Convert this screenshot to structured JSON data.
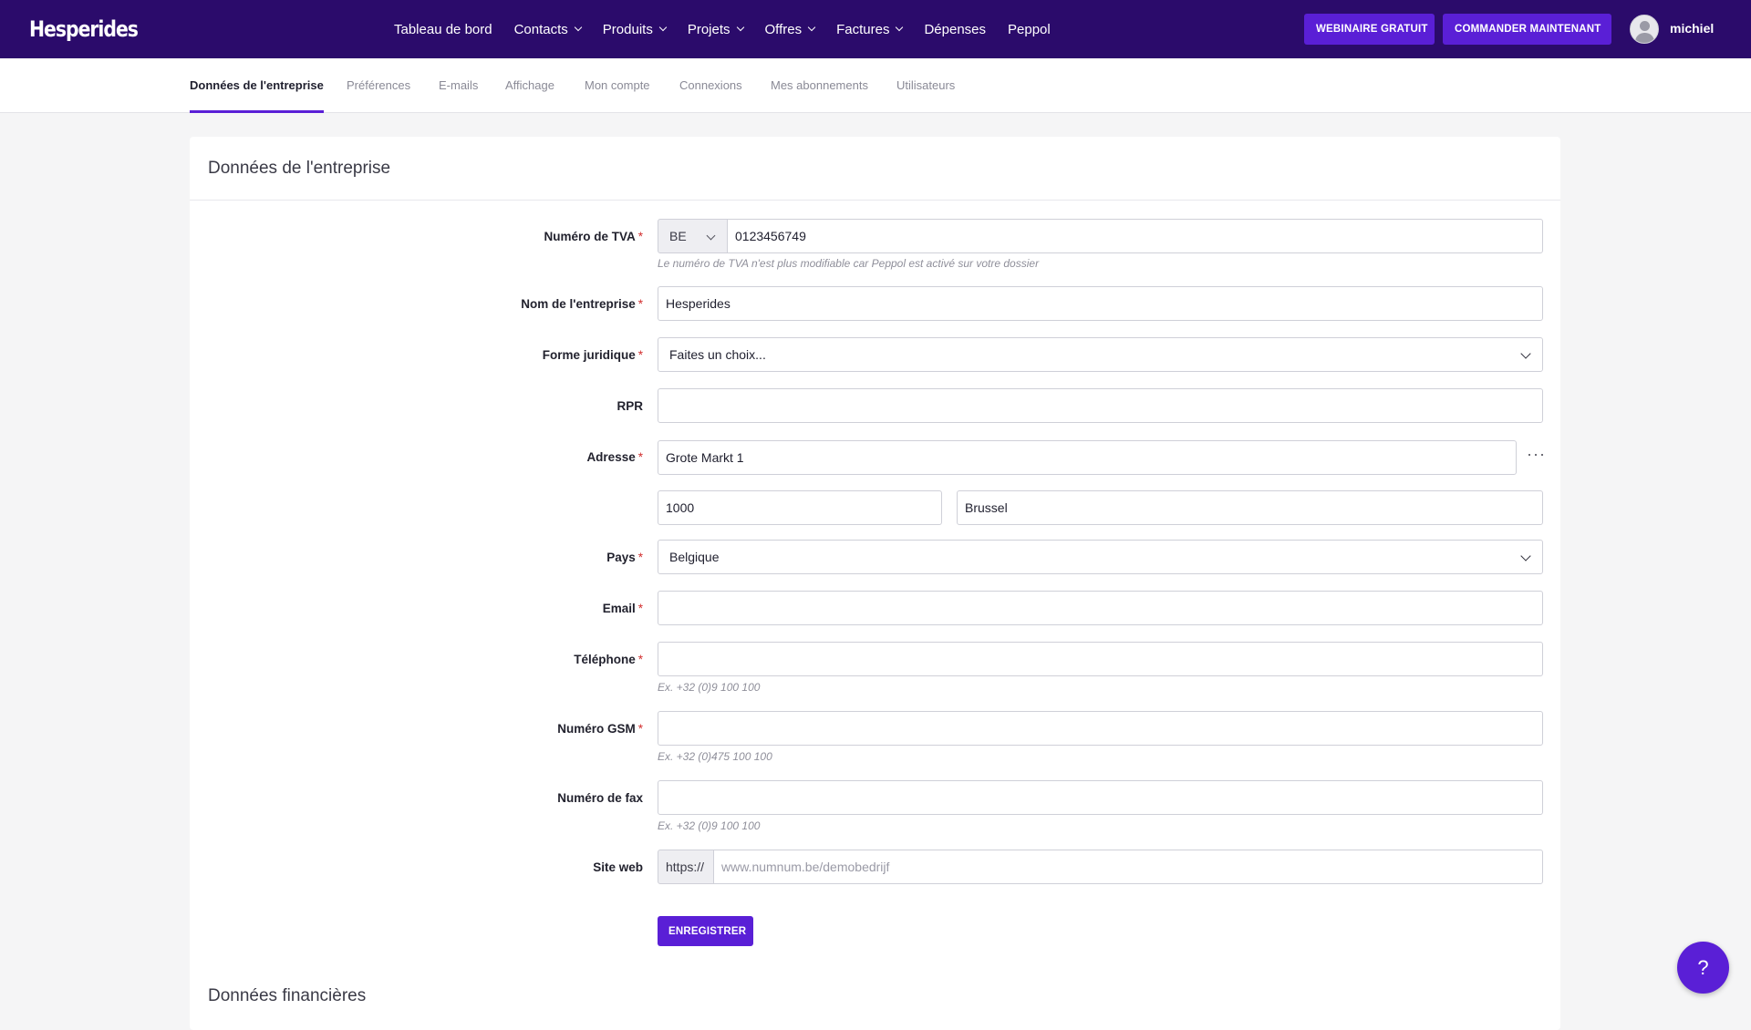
{
  "brand": {
    "name": "Hesperides"
  },
  "nav": {
    "items": [
      {
        "label": "Tableau de bord",
        "dropdown": false
      },
      {
        "label": "Contacts",
        "dropdown": true
      },
      {
        "label": "Produits",
        "dropdown": true
      },
      {
        "label": "Projets",
        "dropdown": true
      },
      {
        "label": "Offres",
        "dropdown": true
      },
      {
        "label": "Factures",
        "dropdown": true
      },
      {
        "label": "Dépenses",
        "dropdown": false
      },
      {
        "label": "Peppol",
        "dropdown": false
      }
    ],
    "webinar_label": "WEBINAIRE GRATUIT",
    "order_label": "COMMANDER MAINTENANT",
    "username": "michiel"
  },
  "tabs": [
    {
      "label": "Données de l'entreprise",
      "active": true
    },
    {
      "label": "Préférences",
      "active": false
    },
    {
      "label": "E-mails",
      "active": false
    },
    {
      "label": "Affichage",
      "active": false
    },
    {
      "label": "Mon compte",
      "active": false
    },
    {
      "label": "Connexions",
      "active": false
    },
    {
      "label": "Mes abonnements",
      "active": false
    },
    {
      "label": "Utilisateurs",
      "active": false
    }
  ],
  "form": {
    "title": "Données de l'entreprise",
    "vat": {
      "label": "Numéro de TVA",
      "country": "BE",
      "value": "0123456749",
      "hint": "Le numéro de TVA n'est plus modifiable car Peppol est activé sur votre dossier"
    },
    "company_name": {
      "label": "Nom de l'entreprise",
      "value": "Hesperides"
    },
    "legal_form": {
      "label": "Forme juridique",
      "value": "Faites un choix..."
    },
    "rpr": {
      "label": "RPR",
      "value": ""
    },
    "address": {
      "label": "Adresse",
      "street": "Grote Markt 1",
      "more": "···",
      "postal_code": "1000",
      "city": "Brussel"
    },
    "country": {
      "label": "Pays",
      "value": "Belgique"
    },
    "email": {
      "label": "Email",
      "value": ""
    },
    "phone": {
      "label": "Téléphone",
      "value": "",
      "hint": "Ex. +32 (0)9 100 100"
    },
    "gsm": {
      "label": "Numéro GSM",
      "value": "",
      "hint": "Ex. +32 (0)475 100 100"
    },
    "fax": {
      "label": "Numéro de fax",
      "value": "",
      "hint": "Ex. +32 (0)9 100 100"
    },
    "website": {
      "label": "Site web",
      "prefix": "https://",
      "placeholder": "www.numnum.be/demobedrijf"
    },
    "save_label": "ENREGISTRER",
    "required_mark": "*"
  },
  "financial": {
    "title": "Données financières"
  },
  "help": {
    "label": "?"
  },
  "colors": {
    "topbar": "#2b0b6b",
    "accent": "#5a1fd6",
    "required": "#d22f2f"
  }
}
